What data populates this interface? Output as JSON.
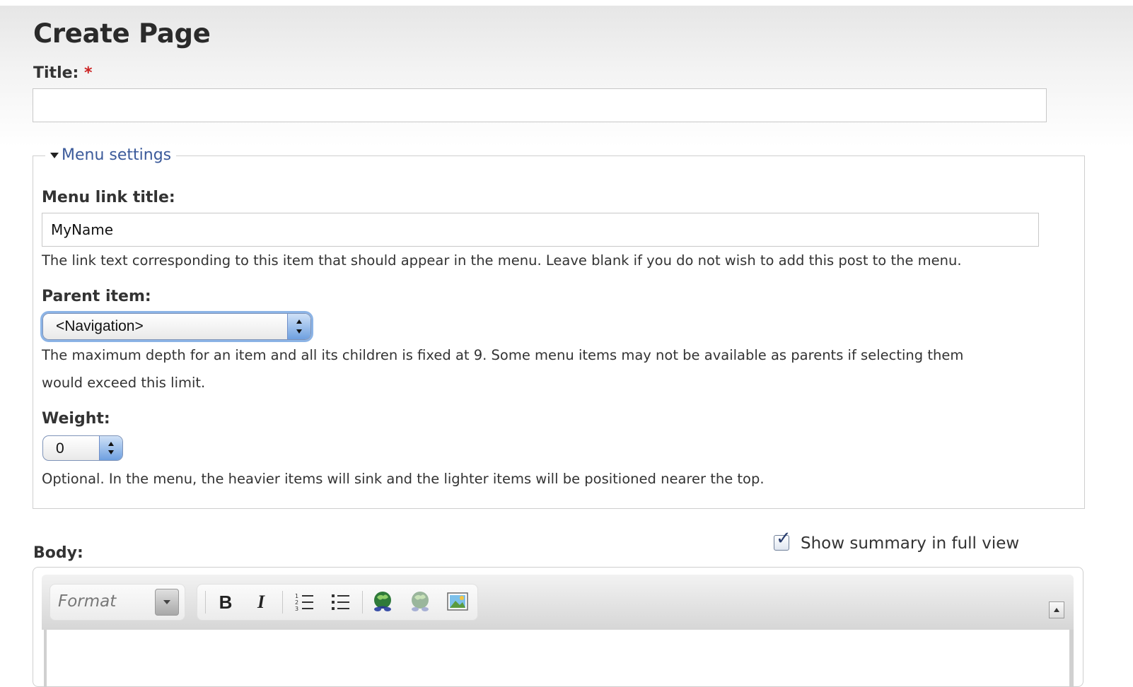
{
  "page": {
    "title": "Create Page"
  },
  "title_field": {
    "label": "Title:",
    "required_marker": "*",
    "value": ""
  },
  "menu_settings": {
    "legend": "Menu settings",
    "link_title": {
      "label": "Menu link title:",
      "value": "MyName",
      "description": "The link text corresponding to this item that should appear in the menu. Leave blank if you do not wish to add this post to the menu."
    },
    "parent_item": {
      "label": "Parent item:",
      "selected": "<Navigation>",
      "description_line1": "The maximum depth for an item and all its children is fixed at 9. Some menu items may not be available as parents if selecting them",
      "description_line2": "would exceed this limit."
    },
    "weight": {
      "label": "Weight:",
      "selected": "0",
      "description": "Optional. In the menu, the heavier items will sink and the lighter items will be positioned nearer the top."
    }
  },
  "body": {
    "label": "Body:",
    "summary_checkbox": {
      "label": "Show summary in full view",
      "checked": true
    },
    "editor": {
      "format_placeholder": "Format",
      "buttons": {
        "bold": "B",
        "italic": "I"
      },
      "icons": [
        "numbered-list-icon",
        "bulleted-list-icon",
        "link-icon",
        "unlink-icon",
        "image-icon",
        "scroll-up-icon"
      ]
    }
  }
}
